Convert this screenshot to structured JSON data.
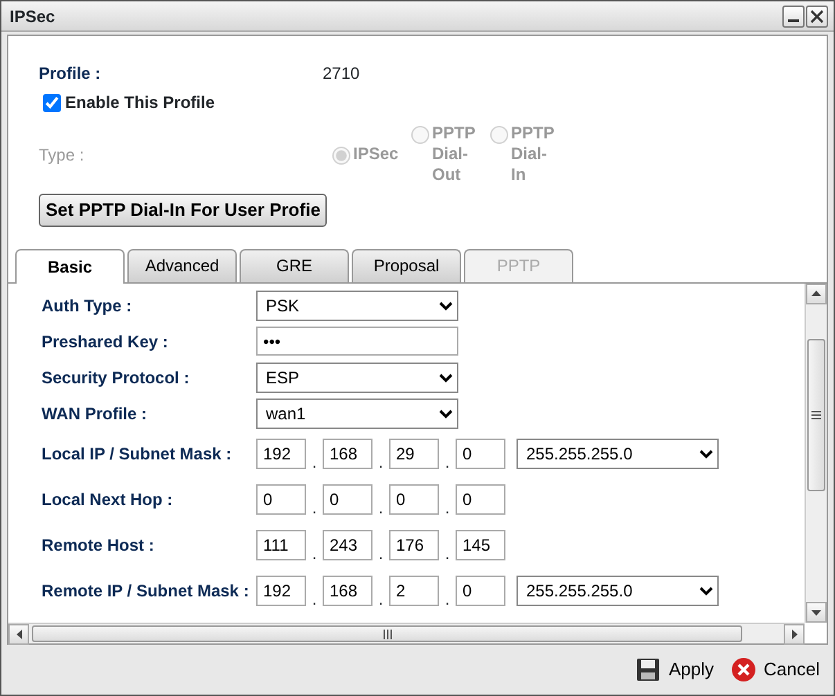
{
  "window": {
    "title": "IPSec"
  },
  "profile": {
    "label": "Profile :",
    "value": "2710"
  },
  "enable": {
    "label": "Enable This Profile",
    "checked": true
  },
  "type": {
    "label": "Type :",
    "disabled": true,
    "options": [
      {
        "label": "IPSec",
        "selected": true
      },
      {
        "label": "PPTP Dial-Out",
        "selected": false
      },
      {
        "label": "PPTP Dial-In",
        "selected": false
      }
    ]
  },
  "set_button": "Set PPTP Dial-In For User Profie",
  "tabs": [
    {
      "label": "Basic",
      "selected": true,
      "disabled": false
    },
    {
      "label": "Advanced",
      "selected": false,
      "disabled": false
    },
    {
      "label": "GRE",
      "selected": false,
      "disabled": false
    },
    {
      "label": "Proposal",
      "selected": false,
      "disabled": false
    },
    {
      "label": "PPTP",
      "selected": false,
      "disabled": true
    }
  ],
  "ip_separator": ".",
  "fields": [
    {
      "kind": "select",
      "label": "Auth Type :",
      "value": "PSK"
    },
    {
      "kind": "password",
      "label": "Preshared Key :",
      "value": "•••"
    },
    {
      "kind": "select",
      "label": "Security Protocol :",
      "value": "ESP"
    },
    {
      "kind": "select",
      "label": "WAN Profile :",
      "value": "wan1"
    },
    {
      "kind": "ip",
      "label": "Local IP / Subnet Mask :",
      "octets": [
        "192",
        "168",
        "29",
        "0"
      ],
      "mask": "255.255.255.0"
    },
    {
      "kind": "ip",
      "label": "Local Next Hop :",
      "octets": [
        "0",
        "0",
        "0",
        "0"
      ]
    },
    {
      "kind": "ip",
      "label": "Remote Host :",
      "octets": [
        "111",
        "243",
        "176",
        "145"
      ]
    },
    {
      "kind": "ip",
      "label": "Remote IP / Subnet Mask :",
      "octets": [
        "192",
        "168",
        "2",
        "0"
      ],
      "mask": "255.255.255.0"
    }
  ],
  "buttons": [
    {
      "kind": "apply",
      "label": "Apply"
    },
    {
      "kind": "cancel",
      "label": "Cancel"
    }
  ]
}
